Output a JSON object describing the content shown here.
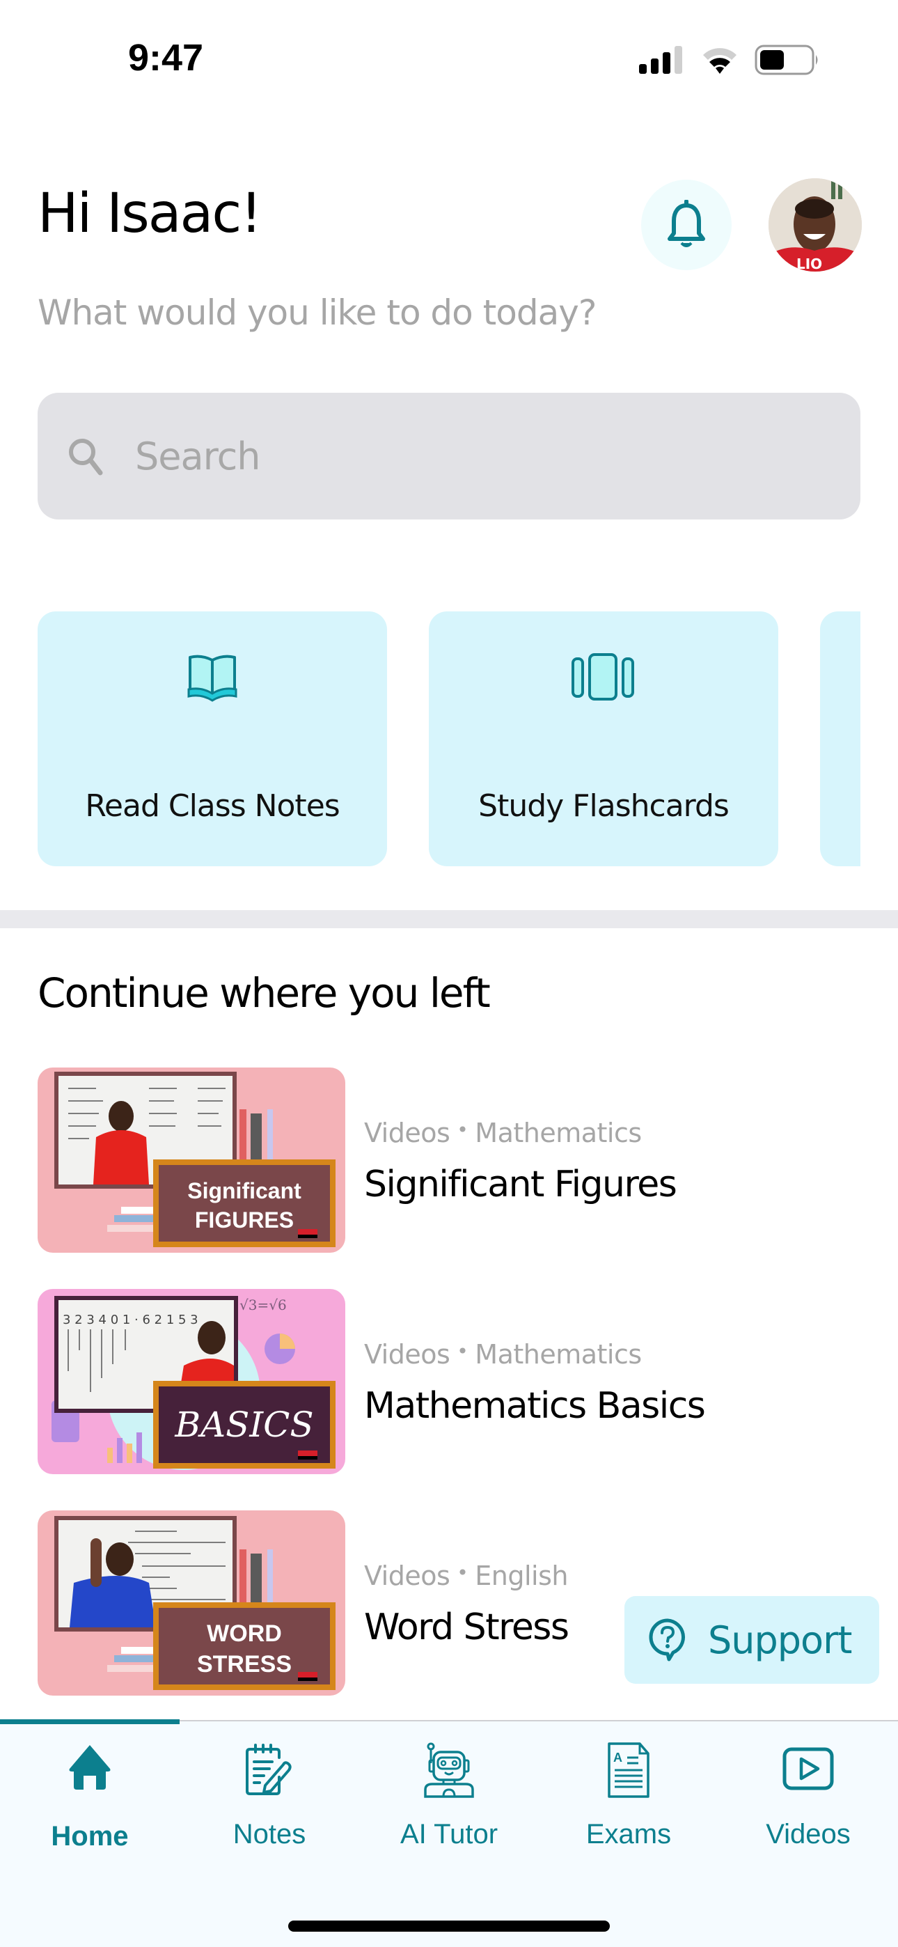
{
  "status_bar": {
    "time": "9:47",
    "signal_icon": "cellular-signal-icon",
    "wifi_icon": "wifi-icon",
    "battery_icon": "battery-icon"
  },
  "header": {
    "greeting": "Hi Isaac!",
    "subtitle": "What would you like to do today?",
    "notification_icon": "bell-icon",
    "avatar_alt": "User avatar"
  },
  "search": {
    "placeholder": "Search",
    "value": "",
    "icon": "search-icon"
  },
  "quick_actions": [
    {
      "label": "Read Class Notes",
      "icon": "open-book-icon"
    },
    {
      "label": "Study Flashcards",
      "icon": "flashcards-icon"
    },
    {
      "label": "",
      "icon": ""
    }
  ],
  "continue_section": {
    "title": "Continue where you left",
    "items": [
      {
        "type": "Videos",
        "subject": "Mathematics",
        "title": "Significant Figures",
        "thumb_caption_line1": "Significant",
        "thumb_caption_line2": "FIGURES",
        "thumb_bg": "#f4b2b7",
        "board_color": "#7a474a",
        "shirt_color": "#e5231e"
      },
      {
        "type": "Videos",
        "subject": "Mathematics",
        "title": "Mathematics Basics",
        "thumb_caption_line1": "BASICS",
        "thumb_caption_line2": "",
        "thumb_bg": "#f6a9da",
        "board_color": "#46213a",
        "shirt_color": "#e5231e"
      },
      {
        "type": "Videos",
        "subject": "English",
        "title": "Word Stress",
        "thumb_caption_line1": "WORD",
        "thumb_caption_line2": "STRESS",
        "thumb_bg": "#f4b2b7",
        "board_color": "#7a474a",
        "shirt_color": "#2447c9"
      }
    ]
  },
  "support_button": {
    "label": "Support",
    "icon": "help-chat-icon"
  },
  "tab_bar": {
    "active_index": 0,
    "tabs": [
      {
        "label": "Home",
        "icon": "home-icon"
      },
      {
        "label": "Notes",
        "icon": "notepad-pencil-icon"
      },
      {
        "label": "AI Tutor",
        "icon": "robot-icon"
      },
      {
        "label": "Exams",
        "icon": "exam-document-icon"
      },
      {
        "label": "Videos",
        "icon": "play-video-icon"
      }
    ]
  },
  "colors": {
    "brand_teal": "#0c7f8e",
    "card_bg": "#d7f5fc",
    "search_bg": "#e2e2e6",
    "muted_text": "#a6a6a6"
  }
}
